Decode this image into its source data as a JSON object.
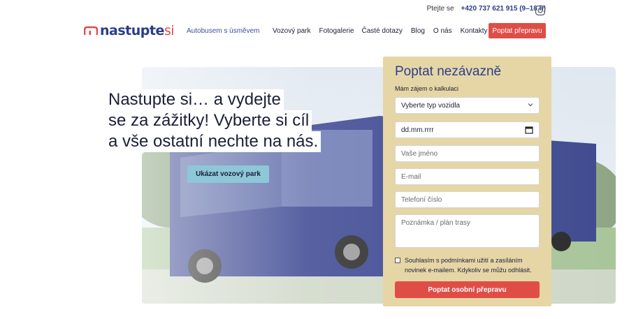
{
  "topbar": {
    "ask_label": "Ptejte se",
    "phone": "+420 737 621 915 (9–18 h)"
  },
  "logo": {
    "name": "nastupte",
    "suffix": "si"
  },
  "tagline": "Autobusem s úsměvem",
  "nav": {
    "items": [
      "Vozový park",
      "Fotogalerie",
      "Časté dotazy",
      "Blog",
      "O nás",
      "Kontakty"
    ],
    "cta": "Poptat přepravu"
  },
  "hero": {
    "headline_lines": [
      "Nastupte si… a vydejte",
      "se za zážitky! Vyberte si cíl",
      "a vše ostatní nechte na nás."
    ],
    "button": "Ukázat vozový park"
  },
  "form": {
    "title": "Poptat nezávazně",
    "subtitle": "Mám zájem o kalkulaci",
    "vehicle_select": "Vyberte typ vozidla",
    "date_placeholder": "dd.mm.rrrr",
    "name_placeholder": "Vaše jméno",
    "email_placeholder": "E-mail",
    "phone_placeholder": "Telefoní číslo",
    "note_placeholder": "Poznámka / plán trasy",
    "consent": "Souhlasím s podmínkami užití a zasíláním novinek e-mailem. Kdykoliv se můžu odhlásit.",
    "submit": "Poptat osobní přepravu"
  },
  "colors": {
    "brand_blue": "#2a3d8a",
    "accent_red": "#e04d47",
    "panel_bg": "#e6d6a6",
    "hero_button": "#8ec7d8"
  }
}
